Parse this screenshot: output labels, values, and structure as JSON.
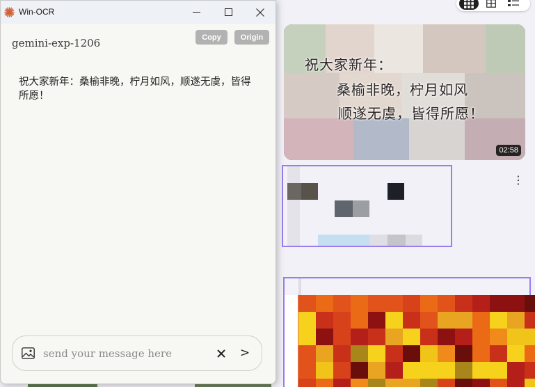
{
  "window": {
    "title": "Win-OCR",
    "model": "gemini-exp-1206",
    "copy_label": "Copy",
    "origin_label": "Origin",
    "ocr_text": "祝大家新年：桑榆非晚，柠月如风，顺遂无虞，皆得所愿！",
    "message": {
      "placeholder": "send your message here",
      "clear_label": "✕",
      "send_label": ">"
    },
    "icons": [
      "sunburst-app-icon",
      "minimize-icon",
      "maximize-icon",
      "close-icon",
      "image-icon",
      "clear-icon",
      "send-icon"
    ]
  },
  "background": {
    "view_toggle": [
      "grid-view-icon",
      "card-view-icon",
      "list-view-icon"
    ],
    "video": {
      "caption_lines": [
        "祝大家新年：",
        "桑榆非晚，柠月如风",
        "顺遂无虞，皆得所愿！"
      ],
      "duration": "02:58"
    },
    "more_label": "⋮"
  },
  "colors": {
    "accent_selection": "#9b7df0",
    "app_icon": "#d2613a",
    "pill": "#b2b2b2"
  }
}
